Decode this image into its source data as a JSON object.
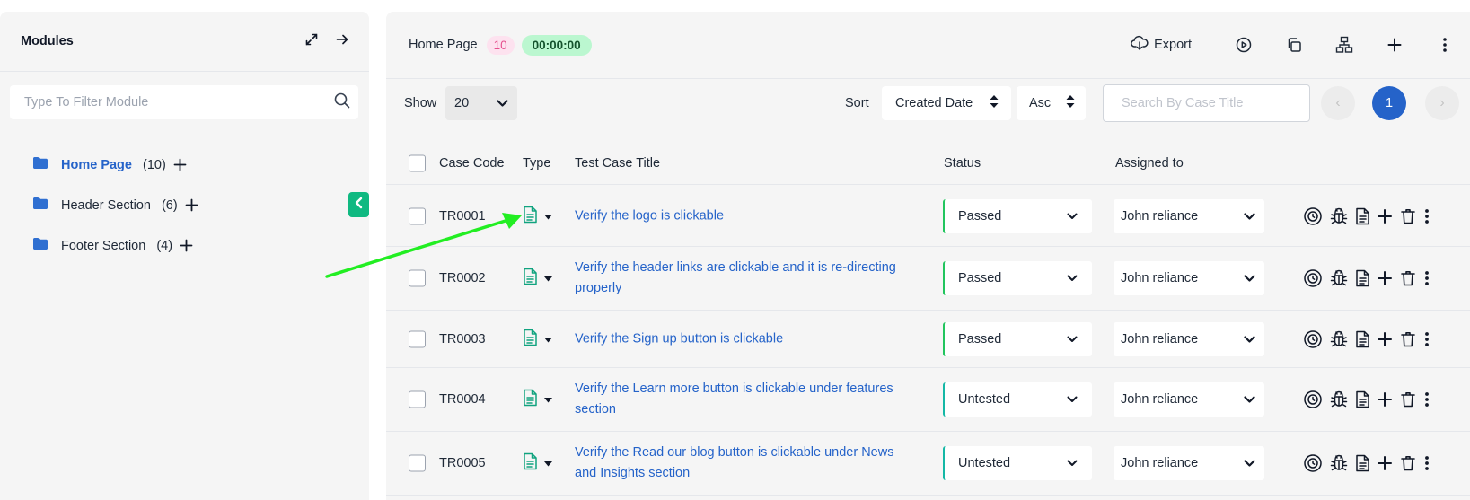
{
  "sidebar": {
    "title": "Modules",
    "filter_placeholder": "Type To Filter Module",
    "modules": [
      {
        "label": "Home Page",
        "count": "(10)",
        "active": true
      },
      {
        "label": "Header Section",
        "count": "(6)",
        "active": false
      },
      {
        "label": "Footer Section",
        "count": "(4)",
        "active": false
      }
    ]
  },
  "header": {
    "page_name": "Home Page",
    "count": "10",
    "timer": "00:00:00",
    "export_label": "Export"
  },
  "filters": {
    "show_label": "Show",
    "show_value": "20",
    "sort_label": "Sort",
    "sort_value": "Created Date",
    "order_value": "Asc",
    "search_placeholder": "Search By Case Title",
    "current_page": "1",
    "prev": "‹",
    "next": "›"
  },
  "table": {
    "columns": {
      "case_code": "Case Code",
      "type": "Type",
      "title": "Test Case Title",
      "status": "Status",
      "assigned": "Assigned to"
    },
    "rows": [
      {
        "code": "TR0001",
        "title": "Verify the logo is clickable",
        "status": "Passed",
        "assignee": "John reliance"
      },
      {
        "code": "TR0002",
        "title": "Verify the header links are clickable and it is re-directing properly",
        "status": "Passed",
        "assignee": "John reliance"
      },
      {
        "code": "TR0003",
        "title": "Verify the Sign up button is clickable",
        "status": "Passed",
        "assignee": "John reliance"
      },
      {
        "code": "TR0004",
        "title": "Verify the Learn more button is clickable under features section",
        "status": "Untested",
        "assignee": "John reliance"
      },
      {
        "code": "TR0005",
        "title": "Verify the Read our blog button is clickable under News and Insights section",
        "status": "Untested",
        "assignee": "John reliance"
      }
    ]
  },
  "colors": {
    "accent_blue": "#2563c9",
    "accent_green": "#10b981",
    "annotation_arrow": "#22ee22"
  }
}
